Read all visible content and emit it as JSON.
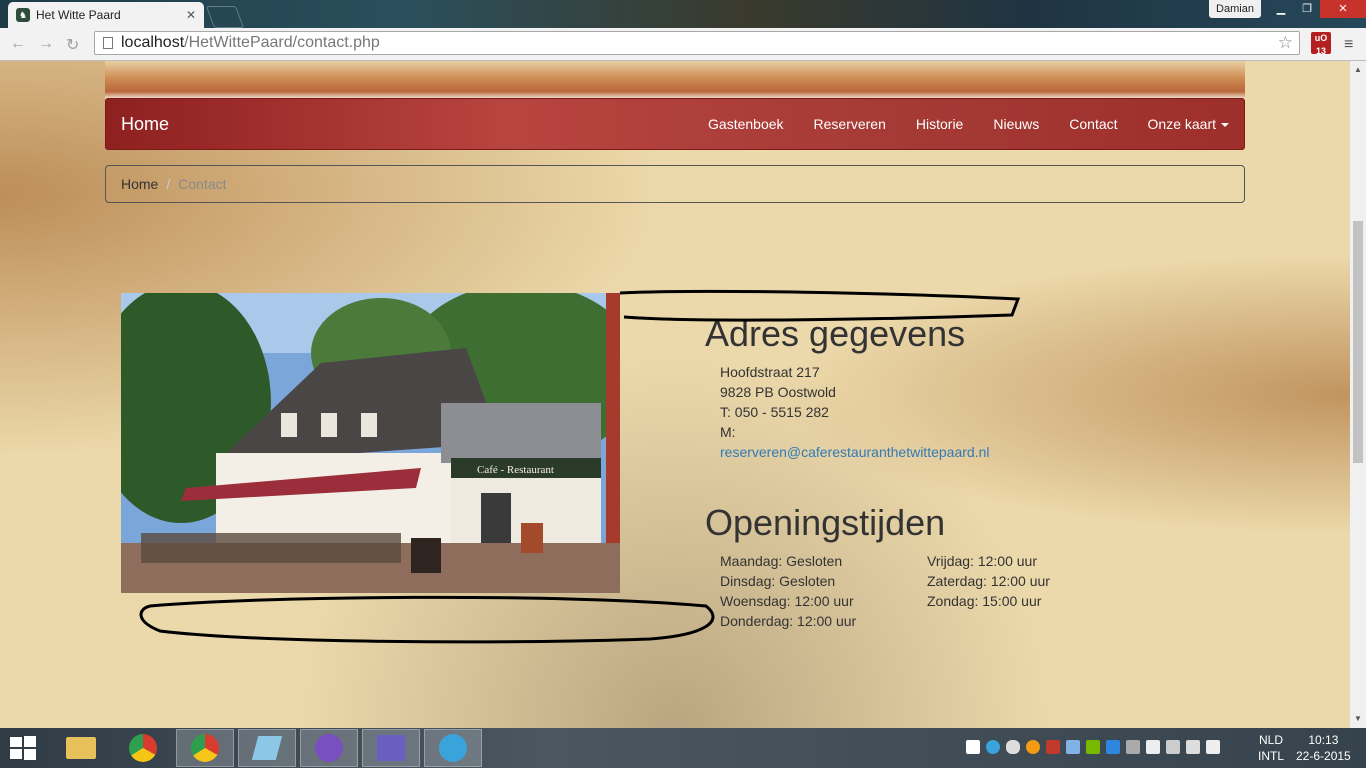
{
  "browser": {
    "tab_title": "Het Witte Paard",
    "tab_close": "✕",
    "user": "Damian",
    "url_host": "localhost",
    "url_path": "/HetWittePaard/contact.php",
    "extension_badge": "13"
  },
  "site": {
    "brand": "Home",
    "nav": [
      "Gastenboek",
      "Reserveren",
      "Historie",
      "Nieuws",
      "Contact"
    ],
    "nav_dropdown": "Onze kaart",
    "breadcrumb": {
      "home": "Home",
      "sep": "/",
      "current": "Contact"
    },
    "photo_sign": "Café - Restaurant",
    "address": {
      "heading": "Adres gegevens",
      "street": "Hoofdstraat 217",
      "postal_city": "9828 PB Oostwold",
      "phone": "T: 050 - 5515 282",
      "mail_label": "M:",
      "email": "reserveren@caferestauranthetwittepaard.nl"
    },
    "hours": {
      "heading": "Openingstijden",
      "left": [
        "Maandag: Gesloten",
        "Dinsdag: Gesloten",
        "Woensdag: 12:00 uur",
        "Donderdag: 12:00 uur"
      ],
      "right": [
        "Vrijdag: 12:00 uur",
        "Zaterdag: 12:00 uur",
        "Zondag: 15:00 uur"
      ]
    }
  },
  "taskbar": {
    "apps": [
      "file-explorer-icon",
      "chrome-icon",
      "chrome-icon",
      "notepad-icon",
      "chat-icon",
      "phpstorm-icon",
      "telegram-icon"
    ],
    "lang_top": "NLD",
    "lang_bottom": "INTL",
    "time": "10:13",
    "date": "22-6-2015"
  },
  "colors": {
    "navbar": "#a53a35",
    "link": "#337ab7",
    "paper": "#ecd9ab"
  }
}
